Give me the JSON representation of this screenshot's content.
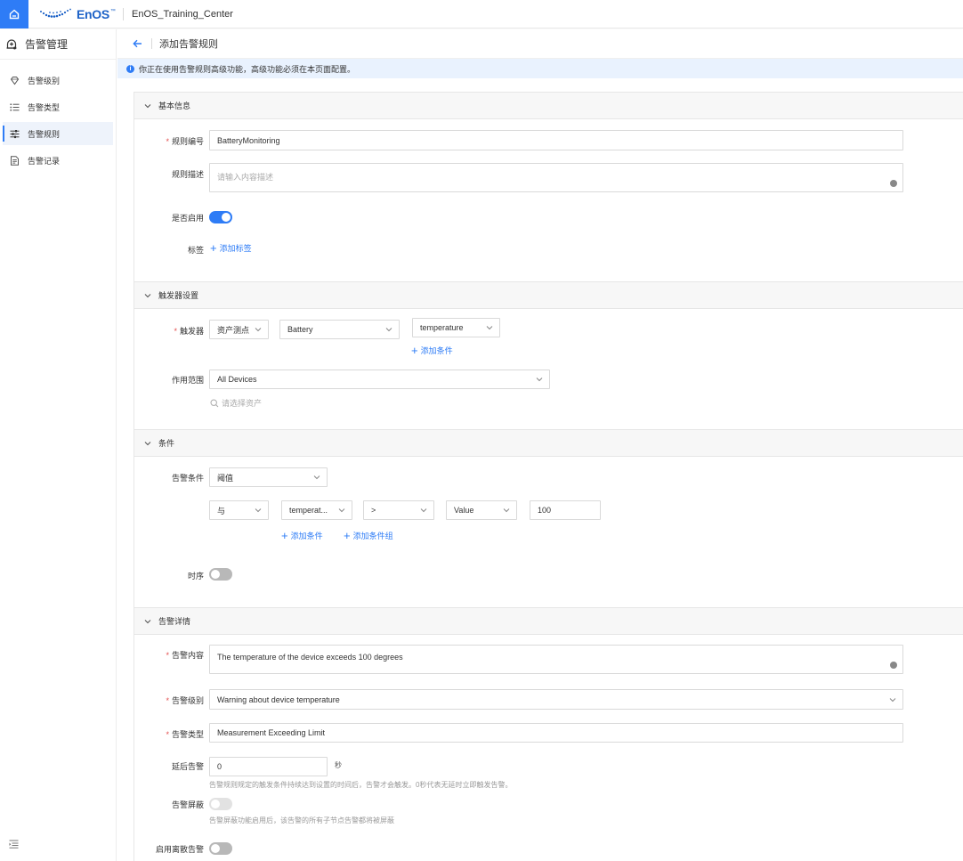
{
  "topbar": {
    "brand": "EnOS",
    "brand_tm": "™",
    "org_name": "EnOS_Training_Center"
  },
  "sidebar": {
    "title": "告警管理",
    "items": [
      {
        "label": "告警级别",
        "icon": "diamond-icon"
      },
      {
        "label": "告警类型",
        "icon": "list-icon"
      },
      {
        "label": "告警规则",
        "icon": "sliders-icon",
        "active": true
      },
      {
        "label": "告警记录",
        "icon": "document-icon"
      }
    ]
  },
  "page": {
    "title": "添加告警规则",
    "info": "你正在使用告警规则高级功能，高级功能必须在本页面配置。"
  },
  "basic": {
    "section_title": "基本信息",
    "rule_id_label": "规则编号",
    "rule_id_value": "BatteryMonitoring",
    "desc_label": "规则描述",
    "desc_placeholder": "请输入内容描述",
    "enabled_label": "是否启用",
    "enabled": true,
    "tags_label": "标签",
    "add_tag": "添加标签"
  },
  "trigger": {
    "section_title": "触发器设置",
    "trigger_label": "触发器",
    "trigger_type": "资产测点",
    "model": "Battery",
    "point": "temperature",
    "add_condition": "添加条件",
    "scope_label": "作用范围",
    "scope_value": "All Devices",
    "asset_placeholder": "请选择资产"
  },
  "condition": {
    "section_title": "条件",
    "cond_label": "告警条件",
    "cond_type": "阈值",
    "logic": "与",
    "field": "temperat...",
    "operator": ">",
    "value_type": "Value",
    "value": "100",
    "add_condition": "添加条件",
    "add_group": "添加条件组",
    "timing_label": "时序",
    "timing": false
  },
  "detail": {
    "section_title": "告警详情",
    "content_label": "告警内容",
    "content_value": "The temperature of the device exceeds 100 degrees",
    "level_label": "告警级别",
    "level_value": "Warning about device temperature",
    "type_label": "告警类型",
    "type_value": "Measurement Exceeding Limit",
    "delay_label": "延后告警",
    "delay_value": "0",
    "delay_unit": "秒",
    "delay_help": "告警规则规定的触发条件持续达到设置的时间后，告警才会触发。0秒代表无延时立即触发告警。",
    "mask_label": "告警屏蔽",
    "mask_help": "告警屏蔽功能启用后，该告警的所有子节点告警都将被屏蔽",
    "discrete_label": "启用离散告警"
  },
  "colors": {
    "primary": "#2e7cf6",
    "required": "#e34d4d"
  }
}
